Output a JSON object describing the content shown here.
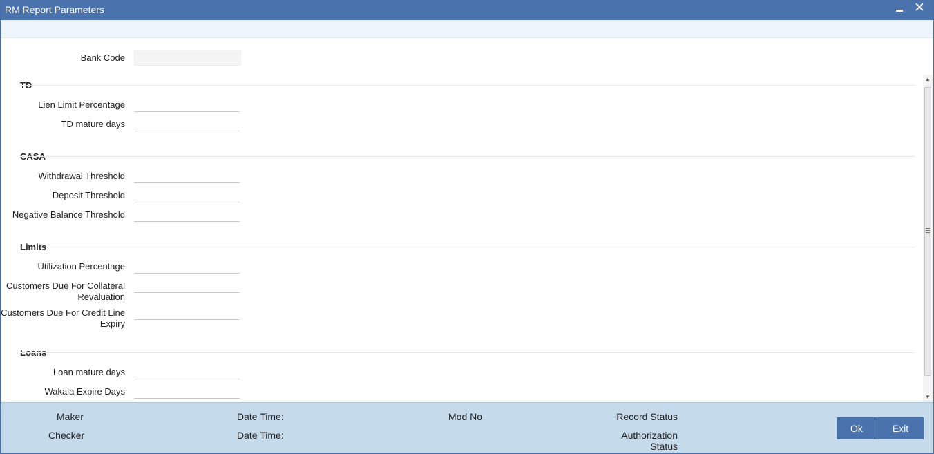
{
  "window": {
    "title": "RM Report Parameters"
  },
  "form": {
    "bank_code": {
      "label": "Bank Code",
      "value": ""
    },
    "sections": {
      "td": {
        "title": "TD",
        "lien_limit": {
          "label": "Lien Limit Percentage",
          "value": ""
        },
        "td_mature_days": {
          "label": "TD mature days",
          "value": ""
        }
      },
      "casa": {
        "title": "CASA",
        "withdrawal_threshold": {
          "label": "Withdrawal Threshold",
          "value": ""
        },
        "deposit_threshold": {
          "label": "Deposit Threshold",
          "value": ""
        },
        "negative_balance_threshold": {
          "label": "Negative Balance Threshold",
          "value": ""
        }
      },
      "limits": {
        "title": "Limits",
        "utilization_percentage": {
          "label": "Utilization Percentage",
          "value": ""
        },
        "collateral_revaluation": {
          "label_line1": "Customers Due For Collateral",
          "label_line2": "Revaluation",
          "value": ""
        },
        "credit_line_expiry": {
          "label_line1": "Customers Due For Credit Line",
          "label_line2": "Expiry",
          "value": ""
        }
      },
      "loans": {
        "title": "Loans",
        "loan_mature_days": {
          "label": "Loan mature days",
          "value": ""
        },
        "wakala_expire_days": {
          "label": "Wakala Expire Days",
          "value": ""
        }
      }
    }
  },
  "footer": {
    "maker": "Maker",
    "checker": "Checker",
    "date_time_1": "Date Time:",
    "date_time_2": "Date Time:",
    "mod_no": "Mod No",
    "record_status": "Record Status",
    "authorization_status_line1": "Authorization",
    "authorization_status_line2": "Status",
    "ok_label": "Ok",
    "exit_label": "Exit"
  },
  "icons": {
    "minimize": "minimize-icon",
    "close": "close-icon",
    "scroll_up": "scroll-up-icon",
    "scroll_down": "scroll-down-icon"
  },
  "colors": {
    "titlebar": "#4a72ad",
    "footer": "#c5daea",
    "button": "#4a72ad"
  }
}
